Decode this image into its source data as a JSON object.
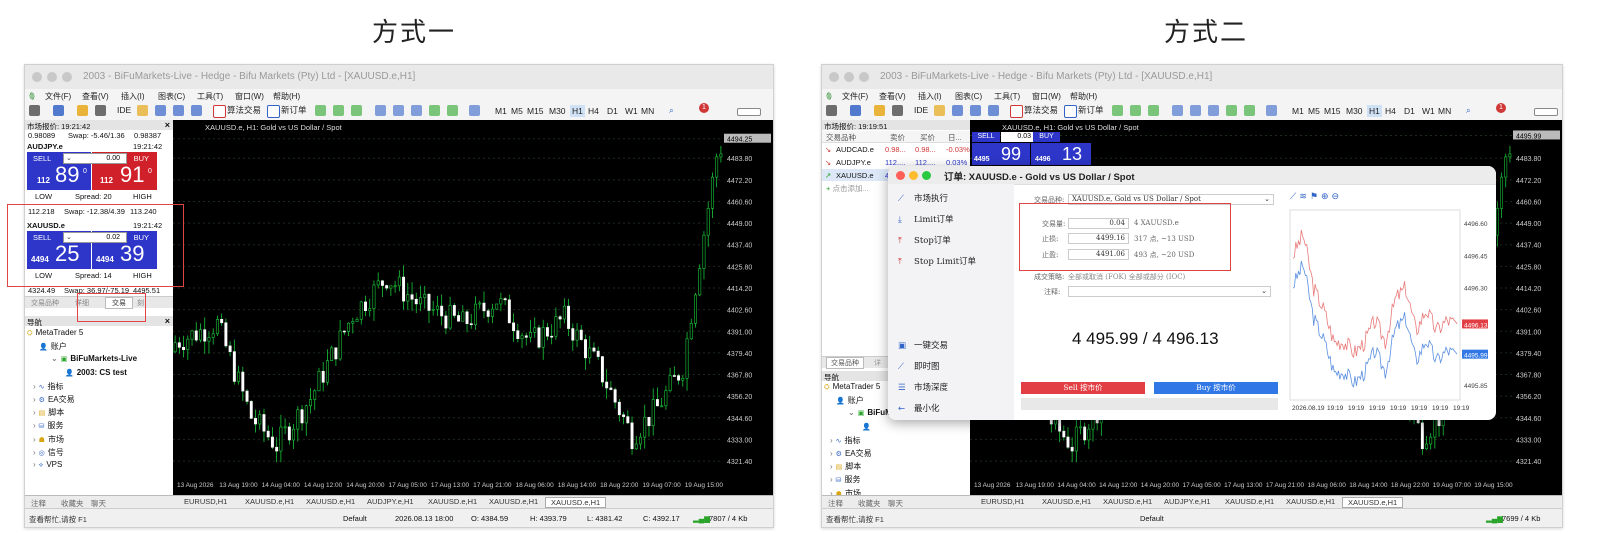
{
  "headings": {
    "left": "方式一",
    "right": "方式二"
  },
  "colors": {
    "sell": "#2d36c8",
    "buy_red": "#d0202a",
    "buy_blue": "#2d36c8",
    "candle_up": "#19c83a",
    "candle_down": "#ffffff",
    "highlight_box": "#e04545",
    "sell_button": "#e23f44",
    "buy_button": "#3178e6"
  },
  "window": {
    "title": "2003 - BiFuMarkets-Live - Hedge - Bifu Markets (Pty) Ltd - [XAUUSD.e,H1]",
    "menu": [
      "文件(F)",
      "查看(V)",
      "插入(I)",
      "图表(C)",
      "工具(T)",
      "窗口(W)",
      "帮助(H)"
    ],
    "toolbar": {
      "ide": "IDE",
      "algo": "算法交易",
      "new_order": "新订单",
      "timeframes": [
        "M1",
        "M5",
        "M15",
        "M30",
        "H1",
        "H4",
        "D1",
        "W1",
        "MN"
      ],
      "selected_tf": "H1",
      "notif_count": "1"
    },
    "chart_title": "XAUUSD.e, H1:  Gold vs US Dollar / Spot",
    "price_ticks": [
      "4494.25",
      "4483.80",
      "4472.20",
      "4460.60",
      "4449.00",
      "4437.40",
      "4425.80",
      "4414.20",
      "4402.60",
      "4391.00",
      "4379.40",
      "4367.80",
      "4356.20",
      "4344.60",
      "4333.00",
      "4321.40"
    ],
    "price_ticks_right": [
      "4495.99",
      "4483.80",
      "4472.20",
      "4460.60",
      "4449.00",
      "4437.40",
      "4425.80",
      "4414.20",
      "4402.60",
      "4391.00",
      "4379.40",
      "4367.80",
      "4356.20",
      "4344.60",
      "4333.00",
      "4321.40"
    ],
    "time_ticks": [
      "13 Aug 2026",
      "13 Aug 19:00",
      "14 Aug 04:00",
      "14 Aug 12:00",
      "14 Aug 20:00",
      "17 Aug 05:00",
      "17 Aug 13:00",
      "17 Aug 21:00",
      "18 Aug 06:00",
      "18 Aug 14:00",
      "18 Aug 22:00",
      "19 Aug 07:00",
      "19 Aug 15:00"
    ],
    "chart_tabs": [
      "EURUSD,H1",
      "XAUUSD.e,H1",
      "XAUUSD.e,H1",
      "AUDJPY.e,H1",
      "XAUUSD.e,H1",
      "XAUUSD.e,H1",
      "XAUUSD.e,H1"
    ],
    "bottom_tabs": [
      "注释",
      "收藏夹",
      "聊天"
    ],
    "status": {
      "help": "查看帮忙,请按 F1",
      "profile": "Default",
      "datetime": "2026.08.13 18:00",
      "open": "O: 4384.59",
      "high": "H: 4393.79",
      "low": "L: 4381.42",
      "close": "C: 4392.17"
    },
    "navigator": {
      "title": "导航",
      "items": [
        "MetaTrader 5",
        "账户",
        "BiFuMarkets-Live",
        "2003: CS test",
        "指标",
        "EA交易",
        "脚本",
        "服务",
        "市场",
        "信号",
        "VPS"
      ]
    }
  },
  "left_window": {
    "market_watch_title": "市场报价: 19:21:42",
    "top_row": [
      "0.98089",
      "Swap: -5.46/1.36",
      "0.98387"
    ],
    "quotes": [
      {
        "symbol": "AUDJPY.e",
        "time": "19:21:42",
        "sell": "SELL",
        "buy": "BUY",
        "lot": "0.00",
        "sell_small": "112",
        "sell_big": "89",
        "sell_sup": "0",
        "buy_small": "112",
        "buy_big": "91",
        "buy_sup": "0",
        "low": "LOW",
        "spread": "Spread: 20",
        "high": "HIGH",
        "low_val": "112.218",
        "swap": "Swap: -12.38/4.39",
        "high_val": "113.240"
      },
      {
        "symbol": "XAUUSD.e",
        "time": "19:21:42",
        "sell": "SELL",
        "buy": "BUY",
        "lot": "0.02",
        "sell_small": "4494",
        "sell_big": "25",
        "buy_small": "4494",
        "buy_big": "39",
        "low": "LOW",
        "spread": "Spread: 14",
        "high": "HIGH",
        "low_val": "4324.49",
        "swap": "Swap: 36.97/-75.19",
        "high_val": "4495.51"
      }
    ],
    "tabs": [
      "交易品种",
      "详细",
      "交易",
      "刻"
    ]
  },
  "right_window": {
    "market_watch_title": "市场报价: 19:19:51",
    "columns": [
      "交易品种",
      "卖价",
      "买价",
      "日..."
    ],
    "rows": [
      {
        "symbol": "AUDCAD.e",
        "bid": "0.98...",
        "ask": "0.98...",
        "change": "-0.03%"
      },
      {
        "symbol": "AUDJPY.e",
        "bid": "112....",
        "ask": "112....",
        "change": "0.03%"
      },
      {
        "symbol": "XAUUSD.e",
        "bid": "4495...",
        "ask": "4496...",
        "change": "0.03%"
      }
    ],
    "add_symbol": "点击添加...",
    "one_click": {
      "sell": "SELL",
      "buy": "BUY",
      "lot": "0.03",
      "sell_small": "4495",
      "sell_big": "99",
      "buy_small": "4496",
      "buy_big": "13"
    },
    "tabs": [
      "交易品种",
      "详"
    ],
    "order": {
      "title": "订单: XAUUSD.e - Gold vs US Dollar / Spot",
      "side_top": [
        "市场执行",
        "Limit订单",
        "Stop订单",
        "Stop Limit订单"
      ],
      "side_bottom": [
        "一键交易",
        "即时图",
        "市场深度",
        "最小化"
      ],
      "symbol_label": "交易品种:",
      "symbol_value": "XAUUSD.e, Gold vs US Dollar / Spot",
      "volume_label": "交易量:",
      "volume_value": "0.04",
      "volume_note": "4 XAUUSD.e",
      "sl_label": "止损:",
      "sl_value": "4499.16",
      "sl_note": "317 点, ~13 USD",
      "tp_label": "止盈:",
      "tp_value": "4491.06",
      "tp_note": "493 点, ~20 USD",
      "fill_label": "成交策略:",
      "fill_value": "全部或取消 (FOK)  全部或部分 (IOC)",
      "comment_label": "注释:",
      "price": "4 495.99 / 4 496.13",
      "sell_button": "Sell 按市价",
      "buy_button": "Buy 按市价",
      "tick_prices": [
        "4496.60",
        "4496.45",
        "4496.30",
        "4496.13",
        "4495.99",
        "4495.85"
      ],
      "tick_times": [
        "2026.08.19",
        "19:19",
        "19:19",
        "19:19",
        "19:19",
        "19:19",
        "19:19",
        "19:19"
      ]
    },
    "status": {
      "help": "查看帮忙,请按 F1",
      "profile": "Default",
      "speed": "7699 / 4 Kb"
    }
  },
  "left_status_speed": "7807 / 4 Kb"
}
